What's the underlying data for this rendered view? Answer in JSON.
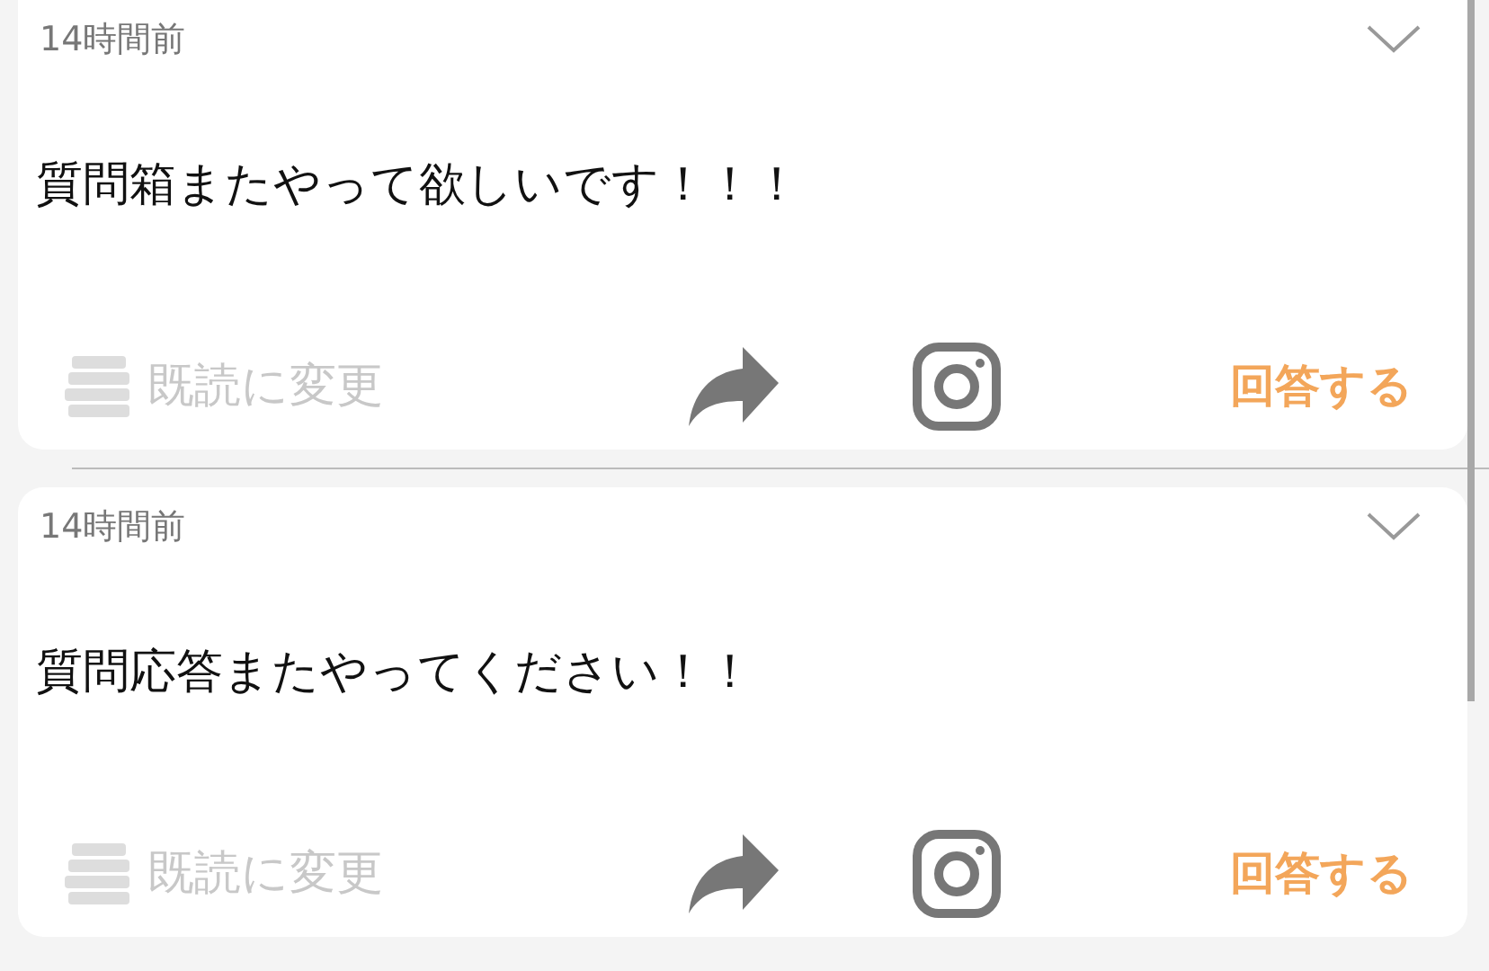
{
  "questions": [
    {
      "time": "14時間前",
      "message": "質問箱またやって欲しいです！！！",
      "mark_read": "既読に変更",
      "answer": "回答する"
    },
    {
      "time": "14時間前",
      "message": "質問応答またやってください！！",
      "mark_read": "既読に変更",
      "answer": "回答する"
    }
  ]
}
